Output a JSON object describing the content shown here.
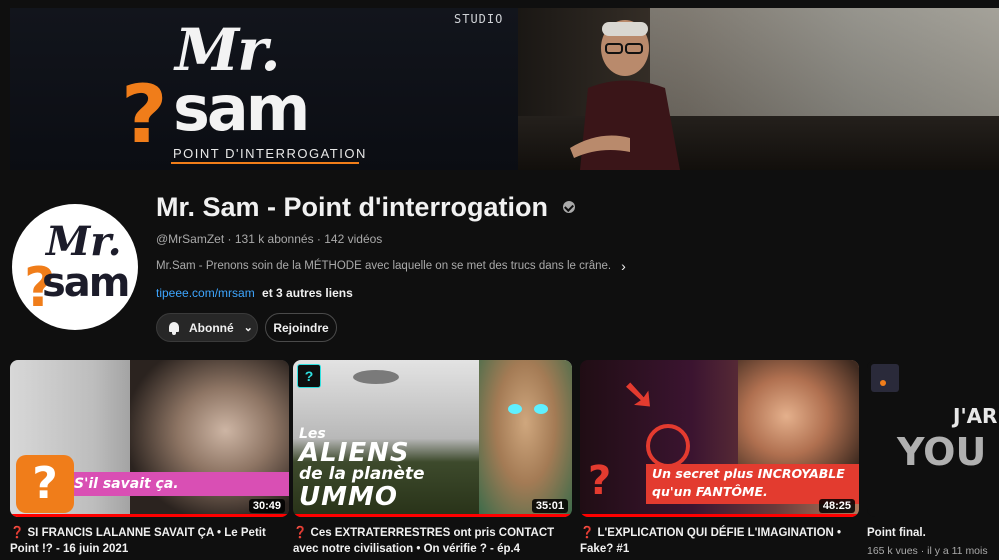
{
  "banner": {
    "studio_label": "STUDIO",
    "logo_mr": "Mr.",
    "logo_sam": "sam",
    "logo_q": "?",
    "logo_tagline": "POINT D'INTERROGATION"
  },
  "avatar": {
    "mr": "Mr.",
    "sam": "sam",
    "q": "?"
  },
  "channel": {
    "title": "Mr. Sam - Point d'interrogation",
    "handle_line": "@MrSamZet · 131 k abonnés · 142 vidéos",
    "description": "Mr.Sam - Prenons soin de la MÉTHODE avec laquelle on se met des trucs dans le crâne.",
    "link": "tipeee.com/mrsam",
    "more_links": "et 3 autres liens"
  },
  "buttons": {
    "subscribed": "Abonné",
    "join": "Rejoindre"
  },
  "videos": [
    {
      "title": "❓ SI FRANCIS LALANNE SAVAIT ÇA • Le Petit Point !? - 16 juin 2021",
      "duration": "30:49",
      "overlay": "S'il savait ça.",
      "badge": "?"
    },
    {
      "title": "❓ Ces EXTRATERRESTRES ont pris CONTACT avec notre civilisation • On vérifie ? - ép.4",
      "duration": "35:01",
      "overlay_1": "Les",
      "overlay_2": "ALIENS",
      "overlay_3": "de la planète",
      "overlay_4": "UMMO",
      "badge": "?"
    },
    {
      "title": "❓ L'EXPLICATION QUI DÉFIE L'IMAGINATION • Fake? #1",
      "duration": "48:25",
      "overlay_1": "Un secret plus INCROYABLE",
      "overlay_2": "qu'un FANTÔME.",
      "badge": "?"
    },
    {
      "title": "Point final.",
      "meta": "165 k vues · il y a 11 mois",
      "overlay_1": "J'AR",
      "overlay_2": "YOU"
    }
  ],
  "colors": {
    "accent_orange": "#f07d1a",
    "link_blue": "#3ea6ff",
    "progress_red": "#ff0000"
  }
}
